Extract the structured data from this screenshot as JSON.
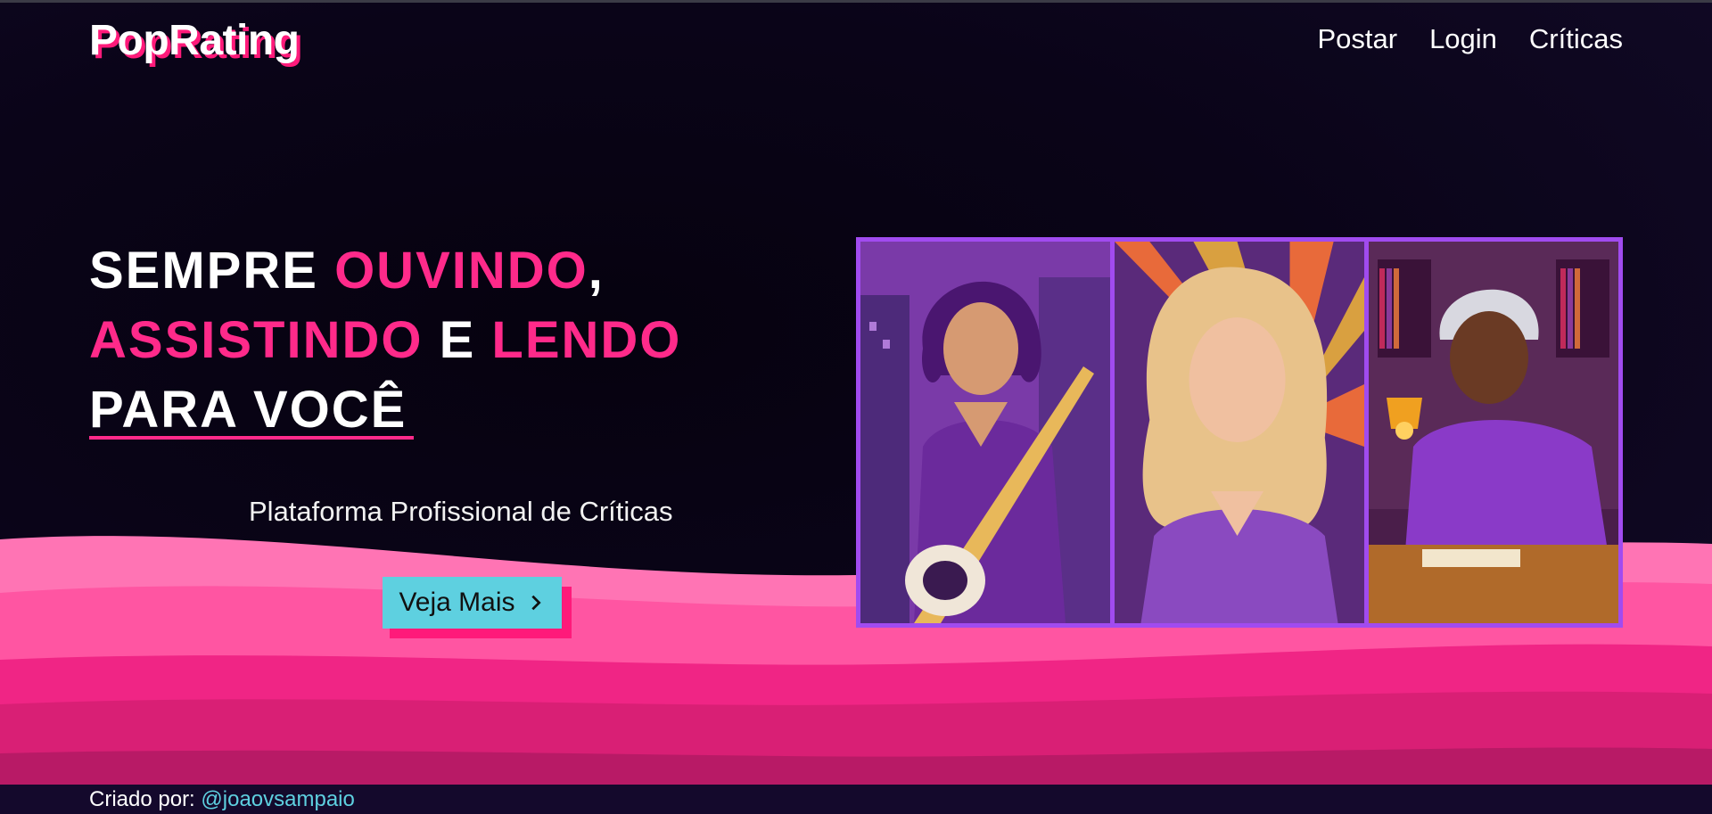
{
  "brand": {
    "logo": "PopRating"
  },
  "nav": {
    "items": [
      "Postar",
      "Login",
      "Críticas"
    ]
  },
  "hero": {
    "line1": {
      "a": "SEMPRE ",
      "b": "OUVINDO",
      "c": ","
    },
    "line2": {
      "a": "ASSISTINDO",
      "b": " E ",
      "c": "LENDO"
    },
    "line3": "PARA VOCÊ",
    "subtitle": "Plataforma Profissional de Críticas",
    "cta_label": "Veja Mais"
  },
  "footer": {
    "label": "Criado por:",
    "handle": "@joaovsampaio"
  },
  "colors": {
    "accent_pink": "#ff2a8a",
    "cta_cyan": "#5ed0e0",
    "frame_purple": "#a14bf0",
    "bg_dark": "#0a0418"
  },
  "icons": {
    "cta": "chevron-right-icon"
  }
}
